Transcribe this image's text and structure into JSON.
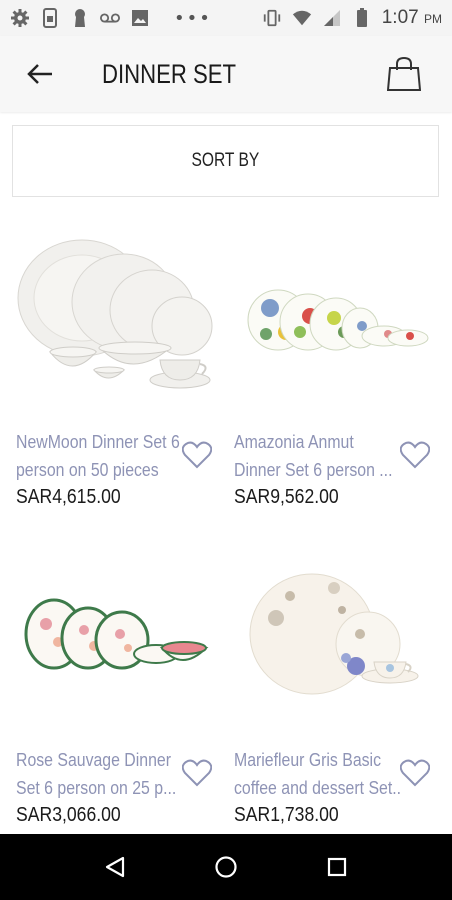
{
  "status_bar": {
    "time": "1:07",
    "ampm": "PM",
    "icons": [
      "gear-icon",
      "sim-card-icon",
      "keyhole-icon",
      "voicemail-icon",
      "image-icon",
      "more-dots-icon",
      "vibrate-icon",
      "wifi-icon",
      "signal-icon",
      "battery-icon"
    ],
    "dots": "•••"
  },
  "header": {
    "title": "DINNER SET",
    "back_icon": "arrow-left-icon",
    "bag_icon": "shopping-bag-icon"
  },
  "sort": {
    "label": "SORT BY"
  },
  "products": [
    {
      "name_line1": "NewMoon Dinner Set 6",
      "name_line2": "person on 50 pieces",
      "price": "SAR4,615.00"
    },
    {
      "name_line1": "Amazonia Anmut",
      "name_line2": "Dinner Set 6  person ...",
      "price": "SAR9,562.00"
    },
    {
      "name_line1": "Rose Sauvage Dinner",
      "name_line2": "Set 6  person on 25 p...",
      "price": "SAR3,066.00"
    },
    {
      "name_line1": "Mariefleur Gris Basic",
      "name_line2": "coffee and dessert Set...",
      "price": "SAR1,738.00"
    }
  ],
  "colors": {
    "product_name": "#8e93b5",
    "price": "#1b1b1b",
    "nav_bar": "#000000",
    "app_bar": "#f7f7f7"
  },
  "nav": {
    "icons": [
      "back-triangle-icon",
      "home-circle-icon",
      "recents-square-icon"
    ]
  }
}
